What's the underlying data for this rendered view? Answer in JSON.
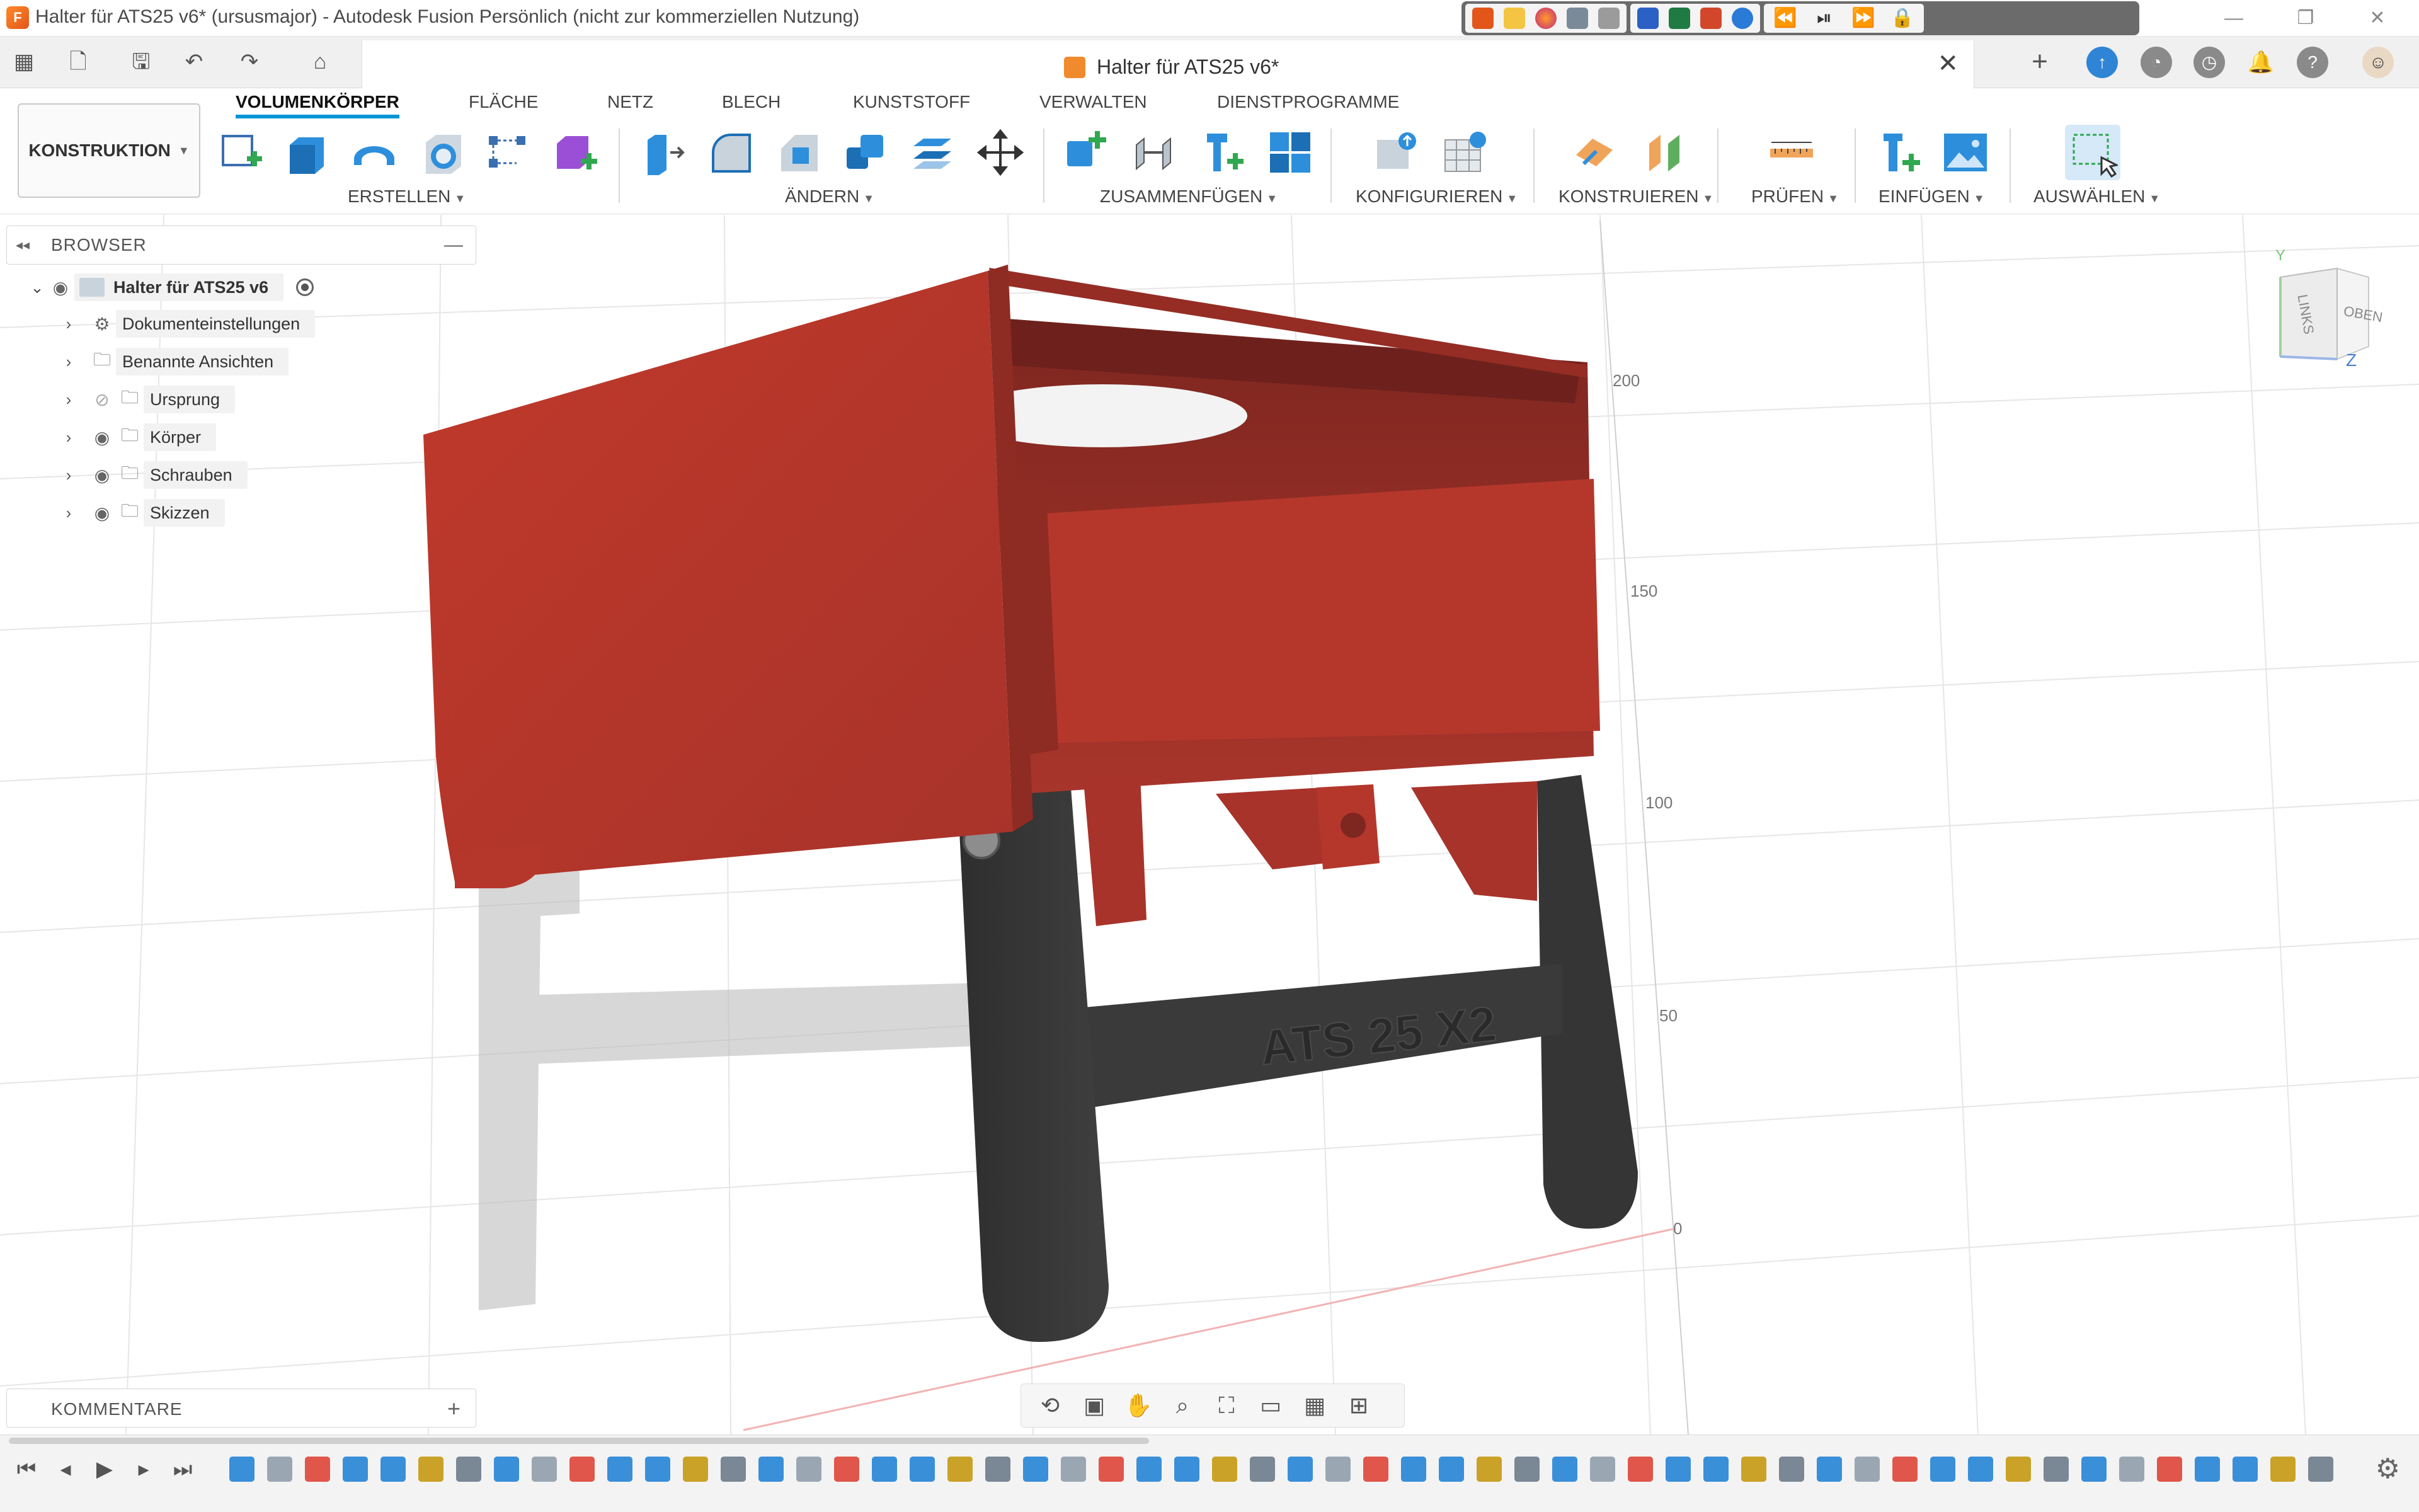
{
  "window": {
    "title": "Halter für ATS25 v6* (ursusmajor) - Autodesk Fusion Persönlich (nicht zur kommerziellen Nutzung)",
    "app_icon": "F",
    "controls": {
      "minimize": "—",
      "restore": "❐",
      "close": "✕"
    }
  },
  "document_tab": {
    "title": "Halter für ATS25 v6*",
    "close_symbol": "✕",
    "new_tab_symbol": "+"
  },
  "ribbon": {
    "workspace": "KONSTRUKTION",
    "tabs": [
      "VOLUMENKÖRPER",
      "FLÄCHE",
      "NETZ",
      "BLECH",
      "KUNSTSTOFF",
      "VERWALTEN",
      "DIENSTPROGRAMME"
    ],
    "active_tab": "VOLUMENKÖRPER",
    "groups": {
      "erstellen": "ERSTELLEN",
      "aendern": "ÄNDERN",
      "zusammenfuegen": "ZUSAMMENFÜGEN",
      "konfigurieren": "KONFIGURIEREN",
      "konstruieren": "KONSTRUIEREN",
      "pruefen": "PRÜFEN",
      "einfuegen": "EINFÜGEN",
      "auswaehlen": "AUSWÄHLEN"
    }
  },
  "browser": {
    "title": "BROWSER",
    "root": "Halter für ATS25 v6",
    "items": [
      {
        "label": "Dokumenteinstellungen",
        "icon": "gear-icon"
      },
      {
        "label": "Benannte Ansichten",
        "icon": "folder-icon"
      },
      {
        "label": "Ursprung",
        "icon": "folder-icon",
        "visible": false
      },
      {
        "label": "Körper",
        "icon": "folder-icon",
        "visible": true
      },
      {
        "label": "Schrauben",
        "icon": "folder-icon",
        "visible": true
      },
      {
        "label": "Skizzen",
        "icon": "folder-icon",
        "visible": true
      }
    ]
  },
  "comments": {
    "title": "KOMMENTARE",
    "add_symbol": "+"
  },
  "viewcube": {
    "left_label": "LINKS",
    "top_label": "OBEN",
    "axis_y": "Y",
    "axis_z": "Z"
  },
  "ruler": {
    "ticks": [
      "200",
      "150",
      "100",
      "50",
      "0"
    ]
  },
  "model": {
    "engraving": "ATS 25 X2",
    "body_color": "#b5372b",
    "legs_color": "#333333"
  },
  "nav_toolbar": [
    "orbit",
    "look-at",
    "pan",
    "zoom",
    "fit",
    "display-settings",
    "grid",
    "viewports"
  ],
  "timeline": {
    "feature_count": 56
  }
}
